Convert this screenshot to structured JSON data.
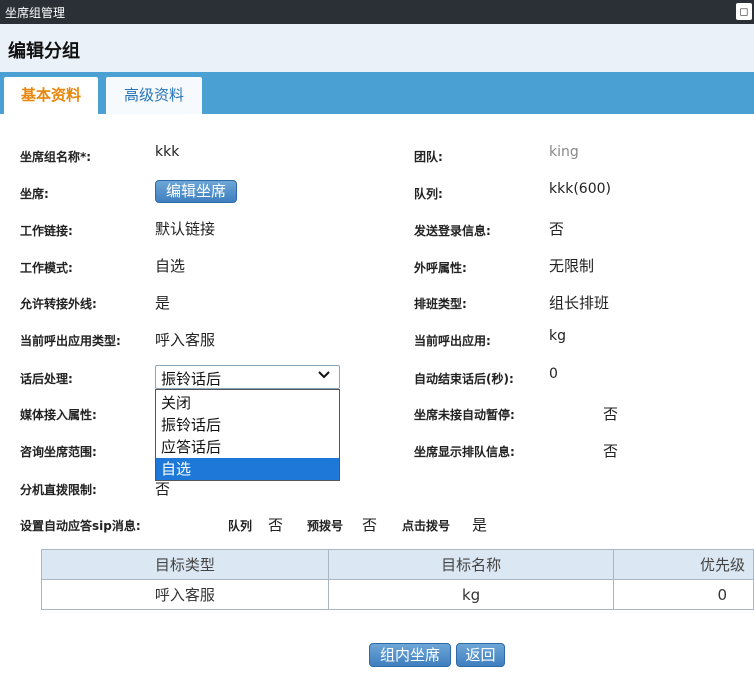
{
  "window": {
    "title": "坐席组管理",
    "button_glyph": "◻"
  },
  "header": {
    "title": "编辑分组"
  },
  "tabs": [
    {
      "label": "基本资料",
      "active": true
    },
    {
      "label": "高级资料",
      "active": false
    }
  ],
  "form": {
    "group_name": {
      "label": "坐席组名称*:",
      "value": "kkk"
    },
    "team": {
      "label": "团队:",
      "value": "king"
    },
    "agents": {
      "label": "坐席:",
      "button": "编辑坐席"
    },
    "queue": {
      "label": "队列:",
      "value": "kkk(600)"
    },
    "work_link": {
      "label": "工作链接:",
      "value": "默认链接"
    },
    "send_login": {
      "label": "发送登录信息:",
      "value": "否"
    },
    "work_mode": {
      "label": "工作模式:",
      "value": "自选"
    },
    "outbound_attr": {
      "label": "外呼属性:",
      "value": "无限制"
    },
    "allow_transfer": {
      "label": "允许转接外线:",
      "value": "是"
    },
    "shift_type": {
      "label": "排班类型:",
      "value": "组长排班"
    },
    "callout_app_type": {
      "label": "当前呼出应用类型:",
      "value": "呼入客服"
    },
    "callout_app": {
      "label": "当前呼出应用:",
      "value": "kg"
    },
    "after_call": {
      "label": "话后处理:",
      "selected": "振铃话后",
      "options": [
        "关闭",
        "振铃话后",
        "应答话后",
        "自选"
      ],
      "highlighted": "自选"
    },
    "auto_end": {
      "label": "自动结束话后(秒):",
      "value": "0"
    },
    "media_attr": {
      "label": "媒体接入属性:"
    },
    "auto_pause": {
      "label": "坐席未接自动暂停:",
      "value": "否"
    },
    "consult_range": {
      "label": "咨询坐席范围:"
    },
    "show_queue": {
      "label": "坐席显示排队信息:",
      "value": "否"
    },
    "ext_limit": {
      "label": "分机直拨限制:",
      "value": "否"
    },
    "sip": {
      "label": "设置自动应答sip消息:",
      "items": [
        {
          "label": "队列",
          "value": "否"
        },
        {
          "label": "预拨号",
          "value": "否"
        },
        {
          "label": "点击拨号",
          "value": "是"
        }
      ]
    }
  },
  "table": {
    "headers": [
      "目标类型",
      "目标名称",
      "优先级"
    ],
    "rows": [
      [
        "呼入客服",
        "kg",
        "0"
      ]
    ]
  },
  "footer": {
    "agents_in_group": "组内坐席",
    "back": "返回"
  }
}
